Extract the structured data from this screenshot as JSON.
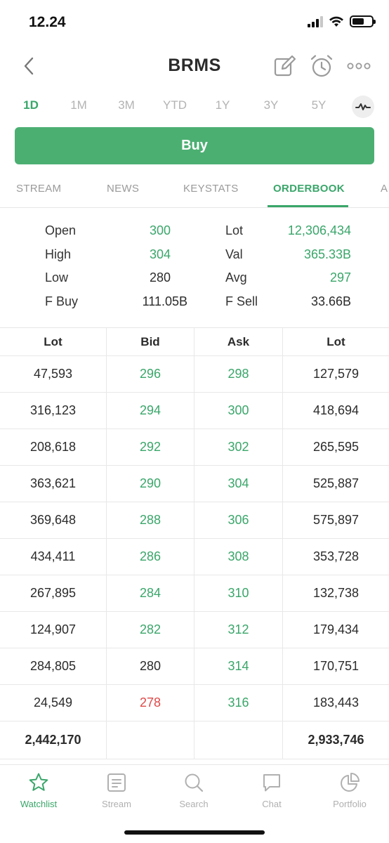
{
  "status_bar": {
    "time": "12.24"
  },
  "header": {
    "title": "BRMS"
  },
  "range_tabs": [
    "1D",
    "1M",
    "3M",
    "YTD",
    "1Y",
    "3Y",
    "5Y"
  ],
  "range_active": "1D",
  "buy_label": "Buy",
  "section_tabs": [
    "STREAM",
    "NEWS",
    "KEYSTATS",
    "ORDERBOOK",
    "A"
  ],
  "section_active": "ORDERBOOK",
  "stats": {
    "open_label": "Open",
    "open_value": "300",
    "high_label": "High",
    "high_value": "304",
    "low_label": "Low",
    "low_value": "280",
    "fbuy_label": "F Buy",
    "fbuy_value": "111.05B",
    "lot_label": "Lot",
    "lot_value": "12,306,434",
    "val_label": "Val",
    "val_value": "365.33B",
    "avg_label": "Avg",
    "avg_value": "297",
    "fsell_label": "F Sell",
    "fsell_value": "33.66B"
  },
  "orderbook": {
    "headers": [
      "Lot",
      "Bid",
      "Ask",
      "Lot"
    ],
    "rows": [
      {
        "bid_lot": "47,593",
        "bid": "296",
        "ask": "298",
        "ask_lot": "127,579"
      },
      {
        "bid_lot": "316,123",
        "bid": "294",
        "ask": "300",
        "ask_lot": "418,694"
      },
      {
        "bid_lot": "208,618",
        "bid": "292",
        "ask": "302",
        "ask_lot": "265,595"
      },
      {
        "bid_lot": "363,621",
        "bid": "290",
        "ask": "304",
        "ask_lot": "525,887"
      },
      {
        "bid_lot": "369,648",
        "bid": "288",
        "ask": "306",
        "ask_lot": "575,897"
      },
      {
        "bid_lot": "434,411",
        "bid": "286",
        "ask": "308",
        "ask_lot": "353,728"
      },
      {
        "bid_lot": "267,895",
        "bid": "284",
        "ask": "310",
        "ask_lot": "132,738"
      },
      {
        "bid_lot": "124,907",
        "bid": "282",
        "ask": "312",
        "ask_lot": "179,434"
      },
      {
        "bid_lot": "284,805",
        "bid": "280",
        "ask": "314",
        "ask_lot": "170,751"
      },
      {
        "bid_lot": "24,549",
        "bid": "278",
        "ask": "316",
        "ask_lot": "183,443"
      }
    ],
    "total_bid_lot": "2,442,170",
    "total_ask_lot": "2,933,746"
  },
  "bottom_tabs": [
    {
      "label": "Watchlist",
      "icon": "star-icon"
    },
    {
      "label": "Stream",
      "icon": "stream-icon"
    },
    {
      "label": "Search",
      "icon": "search-icon"
    },
    {
      "label": "Chat",
      "icon": "chat-icon"
    },
    {
      "label": "Portfolio",
      "icon": "pie-chart-icon"
    }
  ],
  "bottom_active": "Watchlist",
  "colors": {
    "accent": "#3aa66a",
    "buy": "#4caf72",
    "down": "#e04848",
    "neutral": "#2b2b2b"
  }
}
